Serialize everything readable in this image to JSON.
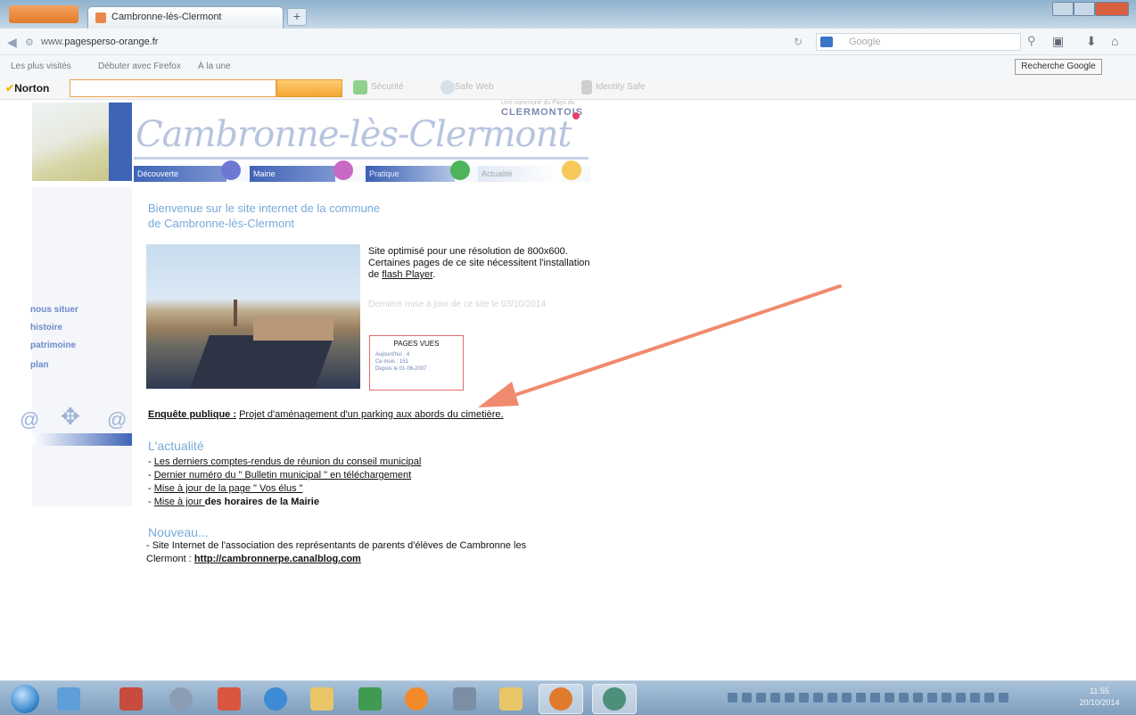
{
  "browser": {
    "tab_title": "Cambronne-lès-Clermont",
    "new_tab": "+",
    "url_prefix": "www.",
    "url_domain": "pagesperso-orange.fr",
    "search_placeholder": "Google",
    "bookmarks": [
      "Les plus visités",
      "Débuter avec Firefox",
      "À la une"
    ],
    "google_search_button": "Recherche Google",
    "norton": {
      "logo": "Norton",
      "items": [
        "Sécurité",
        "Safe Web",
        "Identity Safe"
      ]
    }
  },
  "site": {
    "logo_text": "Cambronne-lès-Clermont",
    "partner_small": "Une commune du Pays du",
    "partner_big": "CLERMONTOIS",
    "menu": [
      "Découverte",
      "Mairie",
      "Pratique",
      "Actualité"
    ],
    "left_nav": [
      "nous situer",
      "histoire",
      "patrimoine",
      "plan"
    ],
    "welcome_line1": "Bienvenue sur le site internet de la commune",
    "welcome_line2": "de Cambronne-lès-Clermont",
    "optimised_text": "Site optimisé pour une résolution de 800x600. Certaines pages de ce site nécessitent l'installation de",
    "flash_link": "flash Player",
    "faded_note": "Dernière mise à jour de ce site le 03/10/2014",
    "counter": {
      "title": "PAGES VUES",
      "lines": [
        "Aujourd'hui : 4",
        "Ce mois : 151",
        "Depuis le 01-06-2007"
      ]
    },
    "enquete_bold": "Enquête publique :",
    "enquete_text": "Projet d'aménagement d'un parking aux abords du cimetière.",
    "actualite_title": "L'actualité",
    "news": [
      {
        "prefix": "- ",
        "link": "Les derniers comptes-rendus de réunion du conseil municipal",
        "bold": ""
      },
      {
        "prefix": "- ",
        "link": "Dernier numéro du \" Bulletin municipal \" en téléchargement",
        "bold": ""
      },
      {
        "prefix": "- ",
        "link": "Mise à jour de la page \" Vos élus \"",
        "bold": ""
      },
      {
        "prefix": "- ",
        "link": "Mise à jour ",
        "bold": "des horaires de la Mairie"
      }
    ],
    "nouveau_title": "Nouveau...",
    "nouveau_text": "- Site Internet de l'association des représentants de parents d'élèves de Cambronne les Clermont :",
    "nouveau_link": "http://cambronnerpe.canalblog.com"
  },
  "taskbar": {
    "clock_time": "11:55",
    "clock_date": "20/10/2014"
  },
  "colors": {
    "accent_blue": "#3e64b6",
    "title_blue": "#78a9d9",
    "arrow": "#f08a6e"
  }
}
